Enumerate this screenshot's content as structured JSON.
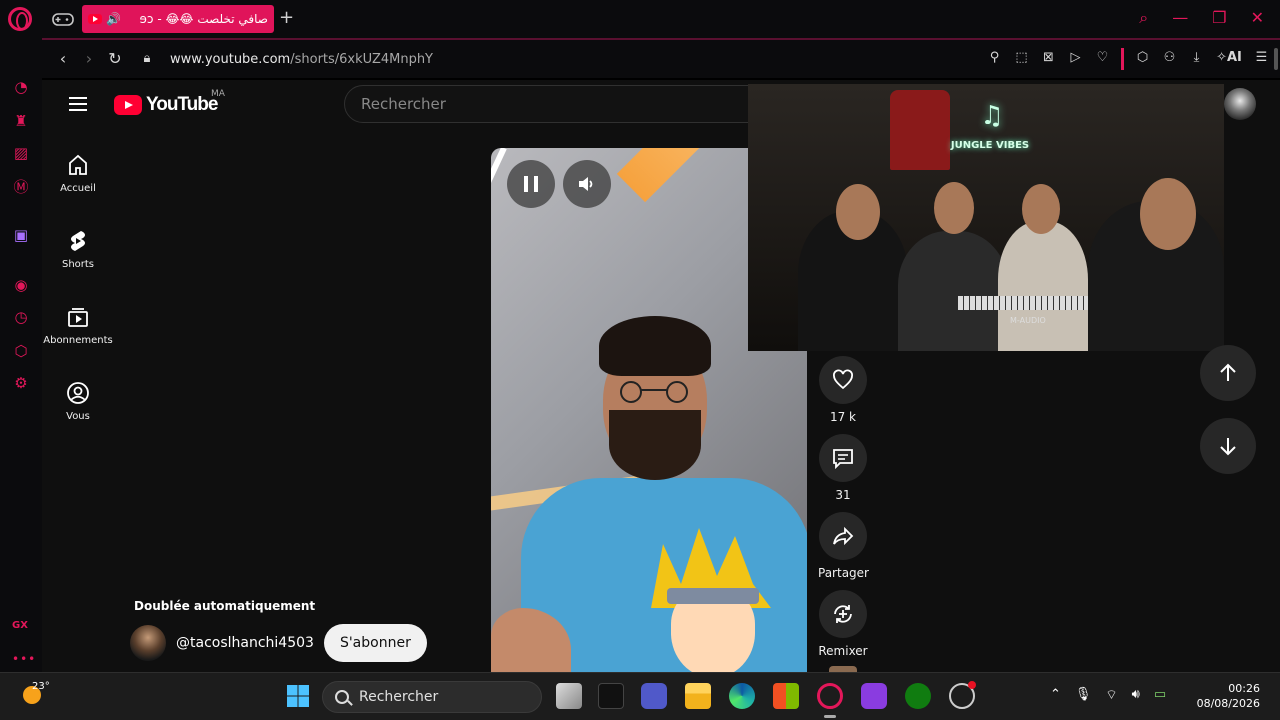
{
  "browser": {
    "tab_title": "صافي تخلصت 😂😂 - ɘɔ",
    "new_tab": "+",
    "url_host": "www.youtube.com",
    "url_path": "/shorts/6xkUZ4MnphY",
    "ai_label": "AI",
    "gx_label": "GX",
    "sidebar_more": "•••",
    "accent_color": "#e3175a"
  },
  "youtube": {
    "logo_text": "YouTube",
    "country_code": "MA",
    "search_placeholder": "Rechercher",
    "guide": [
      {
        "label": "Accueil",
        "icon": "home-icon"
      },
      {
        "label": "Shorts",
        "icon": "shorts-icon"
      },
      {
        "label": "Abonnements",
        "icon": "subscriptions-icon"
      },
      {
        "label": "Vous",
        "icon": "you-icon"
      }
    ],
    "actions": [
      {
        "label": "17 k",
        "icon": "like-icon"
      },
      {
        "label": "31",
        "icon": "comment-icon"
      },
      {
        "label": "Partager",
        "icon": "share-icon"
      },
      {
        "label": "Remixer",
        "icon": "remix-icon"
      }
    ],
    "dub_label": "Doublée automatiquement",
    "channel_handle": "@tacoslhanchi4503",
    "subscribe_label": "S'abonner",
    "pip_sign_text": "JUNGLE VIBES",
    "pip_brand_text": "M-AUDIO"
  },
  "taskbar": {
    "temperature": "23°",
    "search_placeholder": "Rechercher",
    "time": "00:26",
    "date": "08/08/2026"
  }
}
